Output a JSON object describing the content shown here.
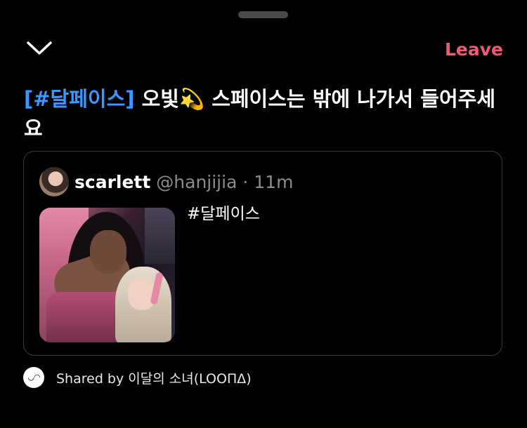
{
  "header": {
    "collapse_icon": "chevron-down-icon",
    "leave_label": "Leave",
    "leave_color": "#f05a73"
  },
  "title": {
    "hashtag_text": "[#달페이스]",
    "rest_text": " 오빛💫 스페이스는 밖에 나가서 들어주세요",
    "hashtag_color": "#3b98ff"
  },
  "post": {
    "display_name": "scarlett",
    "handle": "@hanjijia",
    "separator": "·",
    "time": "11m",
    "text": "#달페이스",
    "avatar_icon": "user-avatar",
    "photo_icon": "attached-photo"
  },
  "footer": {
    "shared_text": "Shared by 이달의 소녀(LOOΠΔ)",
    "avatar_icon": "loona-logo-avatar",
    "avatar_glyph": "◡◠"
  }
}
